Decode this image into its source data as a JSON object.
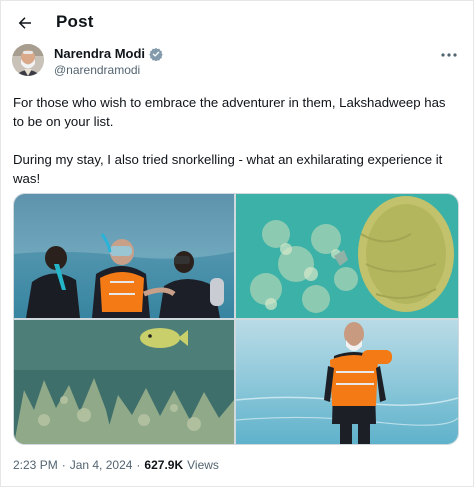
{
  "header": {
    "title": "Post"
  },
  "author": {
    "name": "Narendra Modi",
    "handle": "@narendramodi",
    "verified_color": "#829aab"
  },
  "tweet": {
    "paragraphs": [
      "For those who wish to embrace the adventurer in them, Lakshadweep has to be on your list.",
      "During my stay, I also tried snorkelling - what an exhilarating experience it was!"
    ]
  },
  "media": {
    "photos": [
      "snorkelling-with-guides-photo",
      "coral-reef-underwater-photo",
      "coral-and-fish-photo",
      "man-in-life-jacket-on-water-photo"
    ]
  },
  "meta": {
    "time": "2:23 PM",
    "separator": "·",
    "date": "Jan 4, 2024",
    "views_count": "627.9K",
    "views_label": "Views"
  },
  "colors": {
    "text": "#0f1419",
    "secondary": "#536471",
    "border": "#cfd9de",
    "life_jacket": "#f47a16"
  }
}
